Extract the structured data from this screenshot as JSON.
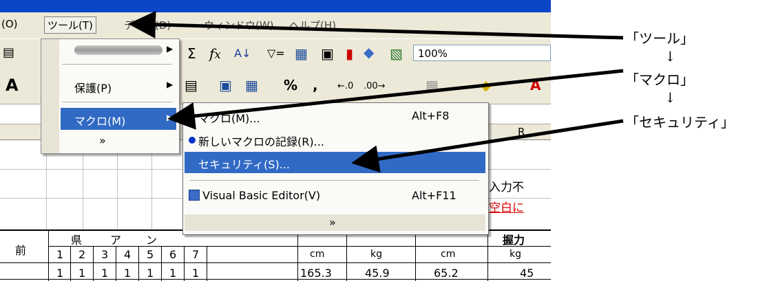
{
  "menubar": {
    "items": [
      "(O)",
      "ツール(T)",
      "データ(D)",
      "ウィンドウ(W)",
      "ヘルプ(H)"
    ]
  },
  "toolbar": {
    "zoom": "100%",
    "icons": [
      "sigma-icon",
      "function-icon",
      "sort-asc-icon",
      "autofilter-icon",
      "form-icon",
      "chart-icon",
      "pivot-icon",
      "map-icon"
    ],
    "format_icons": [
      "percent-icon",
      "comma-icon",
      "increase-decimal-icon",
      "decrease-decimal-icon"
    ]
  },
  "tools_menu": {
    "blurred_item": "",
    "protect": "保護(P)",
    "macro": "マクロ(M)",
    "expand": "»"
  },
  "macro_submenu": {
    "macros": "マクロ(M)...",
    "macros_shortcut": "Alt+F8",
    "record": "新しいマクロの記録(R)...",
    "security": "セキュリティ(S)...",
    "vbe": "Visual Basic Editor(V)",
    "vbe_shortcut": "Alt+F11",
    "expand": "»"
  },
  "sheet": {
    "col_letter": "R",
    "text_input": "入力不",
    "text_blank": "空白に",
    "header_left": "前",
    "header_row": [
      "県",
      "ア",
      "ン"
    ],
    "numbers_row": [
      "1",
      "2",
      "3",
      "4",
      "5",
      "6",
      "7"
    ],
    "units": [
      "cm",
      "kg",
      "cm",
      "kg"
    ],
    "grip_header": "握力",
    "data_row": [
      "1",
      "1",
      "1",
      "1",
      "1",
      "1",
      "1",
      "165.3",
      "45.9",
      "65.2",
      "45"
    ]
  },
  "annotations": {
    "tool": "「ツール」",
    "macro": "「マクロ」",
    "security": "「セキュリティ」",
    "arrow": "↓"
  },
  "colors": {
    "selection": "#316ac5",
    "title_blue": "#0b46c8",
    "red_text": "#e00000"
  }
}
